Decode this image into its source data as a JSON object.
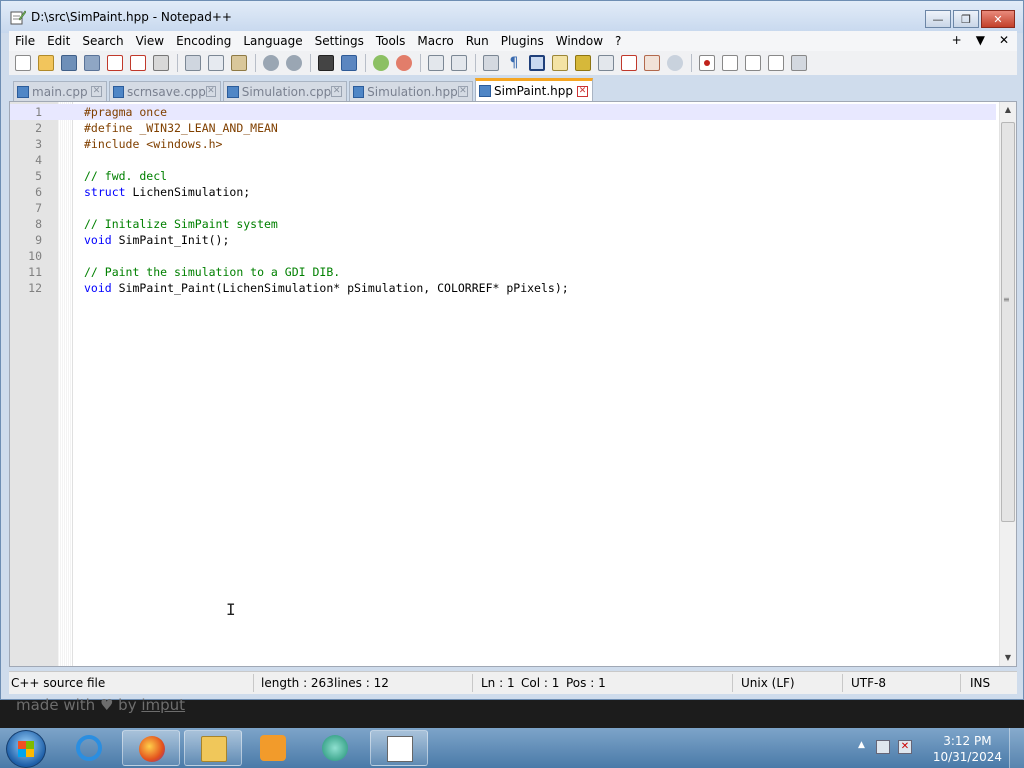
{
  "window": {
    "title": "D:\\src\\SimPaint.hpp - Notepad++",
    "minimize_glyph": "—",
    "maximize_glyph": "❐",
    "close_glyph": "✕"
  },
  "menu": {
    "items": [
      "File",
      "Edit",
      "Search",
      "View",
      "Encoding",
      "Language",
      "Settings",
      "Tools",
      "Macro",
      "Run",
      "Plugins",
      "Window",
      "?"
    ],
    "right_add": "+",
    "right_dropdown": "▼",
    "right_close": "✕"
  },
  "tabs": [
    {
      "label": "main.cpp",
      "active": false
    },
    {
      "label": "scrnsave.cpp",
      "active": false
    },
    {
      "label": "Simulation.cpp",
      "active": false
    },
    {
      "label": "Simulation.hpp",
      "active": false
    },
    {
      "label": "SimPaint.hpp",
      "active": true
    }
  ],
  "tab_close_glyph": "✕",
  "editor": {
    "lines": [
      {
        "n": "1",
        "tokens": [
          {
            "t": "#pragma once",
            "c": "pre"
          }
        ]
      },
      {
        "n": "2",
        "tokens": [
          {
            "t": "#define _WIN32_LEAN_AND_MEAN",
            "c": "pre"
          }
        ]
      },
      {
        "n": "3",
        "tokens": [
          {
            "t": "#include <windows.h>",
            "c": "pre"
          }
        ]
      },
      {
        "n": "4",
        "tokens": []
      },
      {
        "n": "5",
        "tokens": [
          {
            "t": "// fwd. decl",
            "c": "com"
          }
        ]
      },
      {
        "n": "6",
        "tokens": [
          {
            "t": "struct",
            "c": "kw"
          },
          {
            "t": " LichenSimulation;",
            "c": "id"
          }
        ]
      },
      {
        "n": "7",
        "tokens": []
      },
      {
        "n": "8",
        "tokens": [
          {
            "t": "// Initalize SimPaint system",
            "c": "com"
          }
        ]
      },
      {
        "n": "9",
        "tokens": [
          {
            "t": "void",
            "c": "kw"
          },
          {
            "t": " SimPaint_Init();",
            "c": "id"
          }
        ]
      },
      {
        "n": "10",
        "tokens": []
      },
      {
        "n": "11",
        "tokens": [
          {
            "t": "// Paint the simulation to a GDI DIB.",
            "c": "com"
          }
        ]
      },
      {
        "n": "12",
        "tokens": [
          {
            "t": "void",
            "c": "kw"
          },
          {
            "t": " SimPaint_Paint(LichenSimulation* pSimulation, COLORREF* pPixels);",
            "c": "id"
          }
        ]
      }
    ],
    "current_line": 1
  },
  "status": {
    "file_type": "C++ source file",
    "length": "length : 263",
    "lines": "lines : 12",
    "ln": "Ln : 1",
    "col": "Col : 1",
    "pos": "Pos : 1",
    "eol": "Unix (LF)",
    "encoding": "UTF-8",
    "mode": "INS"
  },
  "watermark": {
    "made_with": "made with",
    "heart": "♥",
    "by": "by",
    "link": "imput"
  },
  "taskbar": {
    "time": "3:12 PM",
    "date": "10/31/2024"
  },
  "colors": {
    "preprocessor": "#804000",
    "comment": "#008000",
    "keyword": "#0000ff",
    "active_tab_accent": "#f5a623",
    "current_line": "#e8e8ff"
  }
}
